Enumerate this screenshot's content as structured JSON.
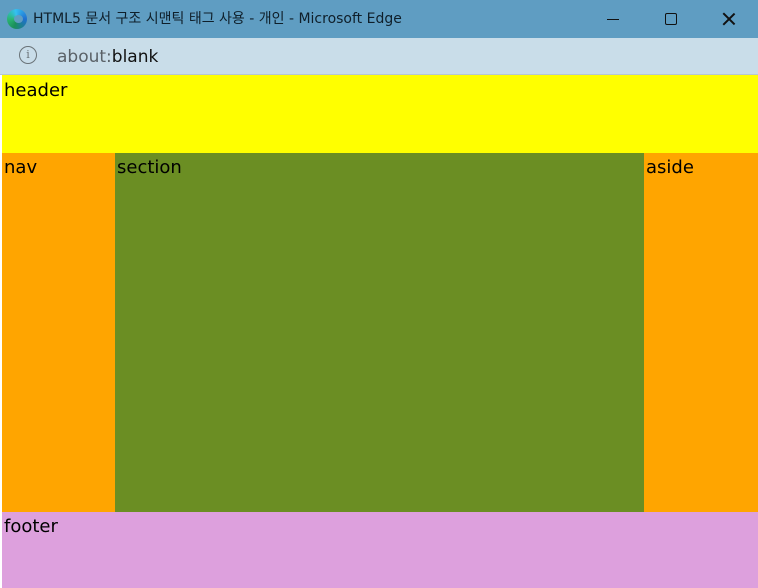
{
  "window": {
    "title": "HTML5 문서 구조 시맨틱 태그 사용 - 개인 - Microsoft Edge",
    "app_icon": "edge-logo-icon",
    "controls": {
      "minimize_icon": "minimize-icon",
      "maximize_icon": "maximize-icon",
      "close_icon": "close-icon"
    }
  },
  "address_bar": {
    "info_icon": "info-icon",
    "url_scheme": "about:",
    "url_path": "blank"
  },
  "page": {
    "header": {
      "label": "header",
      "color": "#ffff00"
    },
    "nav": {
      "label": "nav",
      "color": "#ffa500"
    },
    "section": {
      "label": "section",
      "color": "#6b8e23"
    },
    "aside": {
      "label": "aside",
      "color": "#ffa500"
    },
    "footer": {
      "label": "footer",
      "color": "#dda0dd"
    }
  },
  "colors": {
    "titlebar": "#5f9dc2",
    "addressbar": "#c9dde9"
  }
}
